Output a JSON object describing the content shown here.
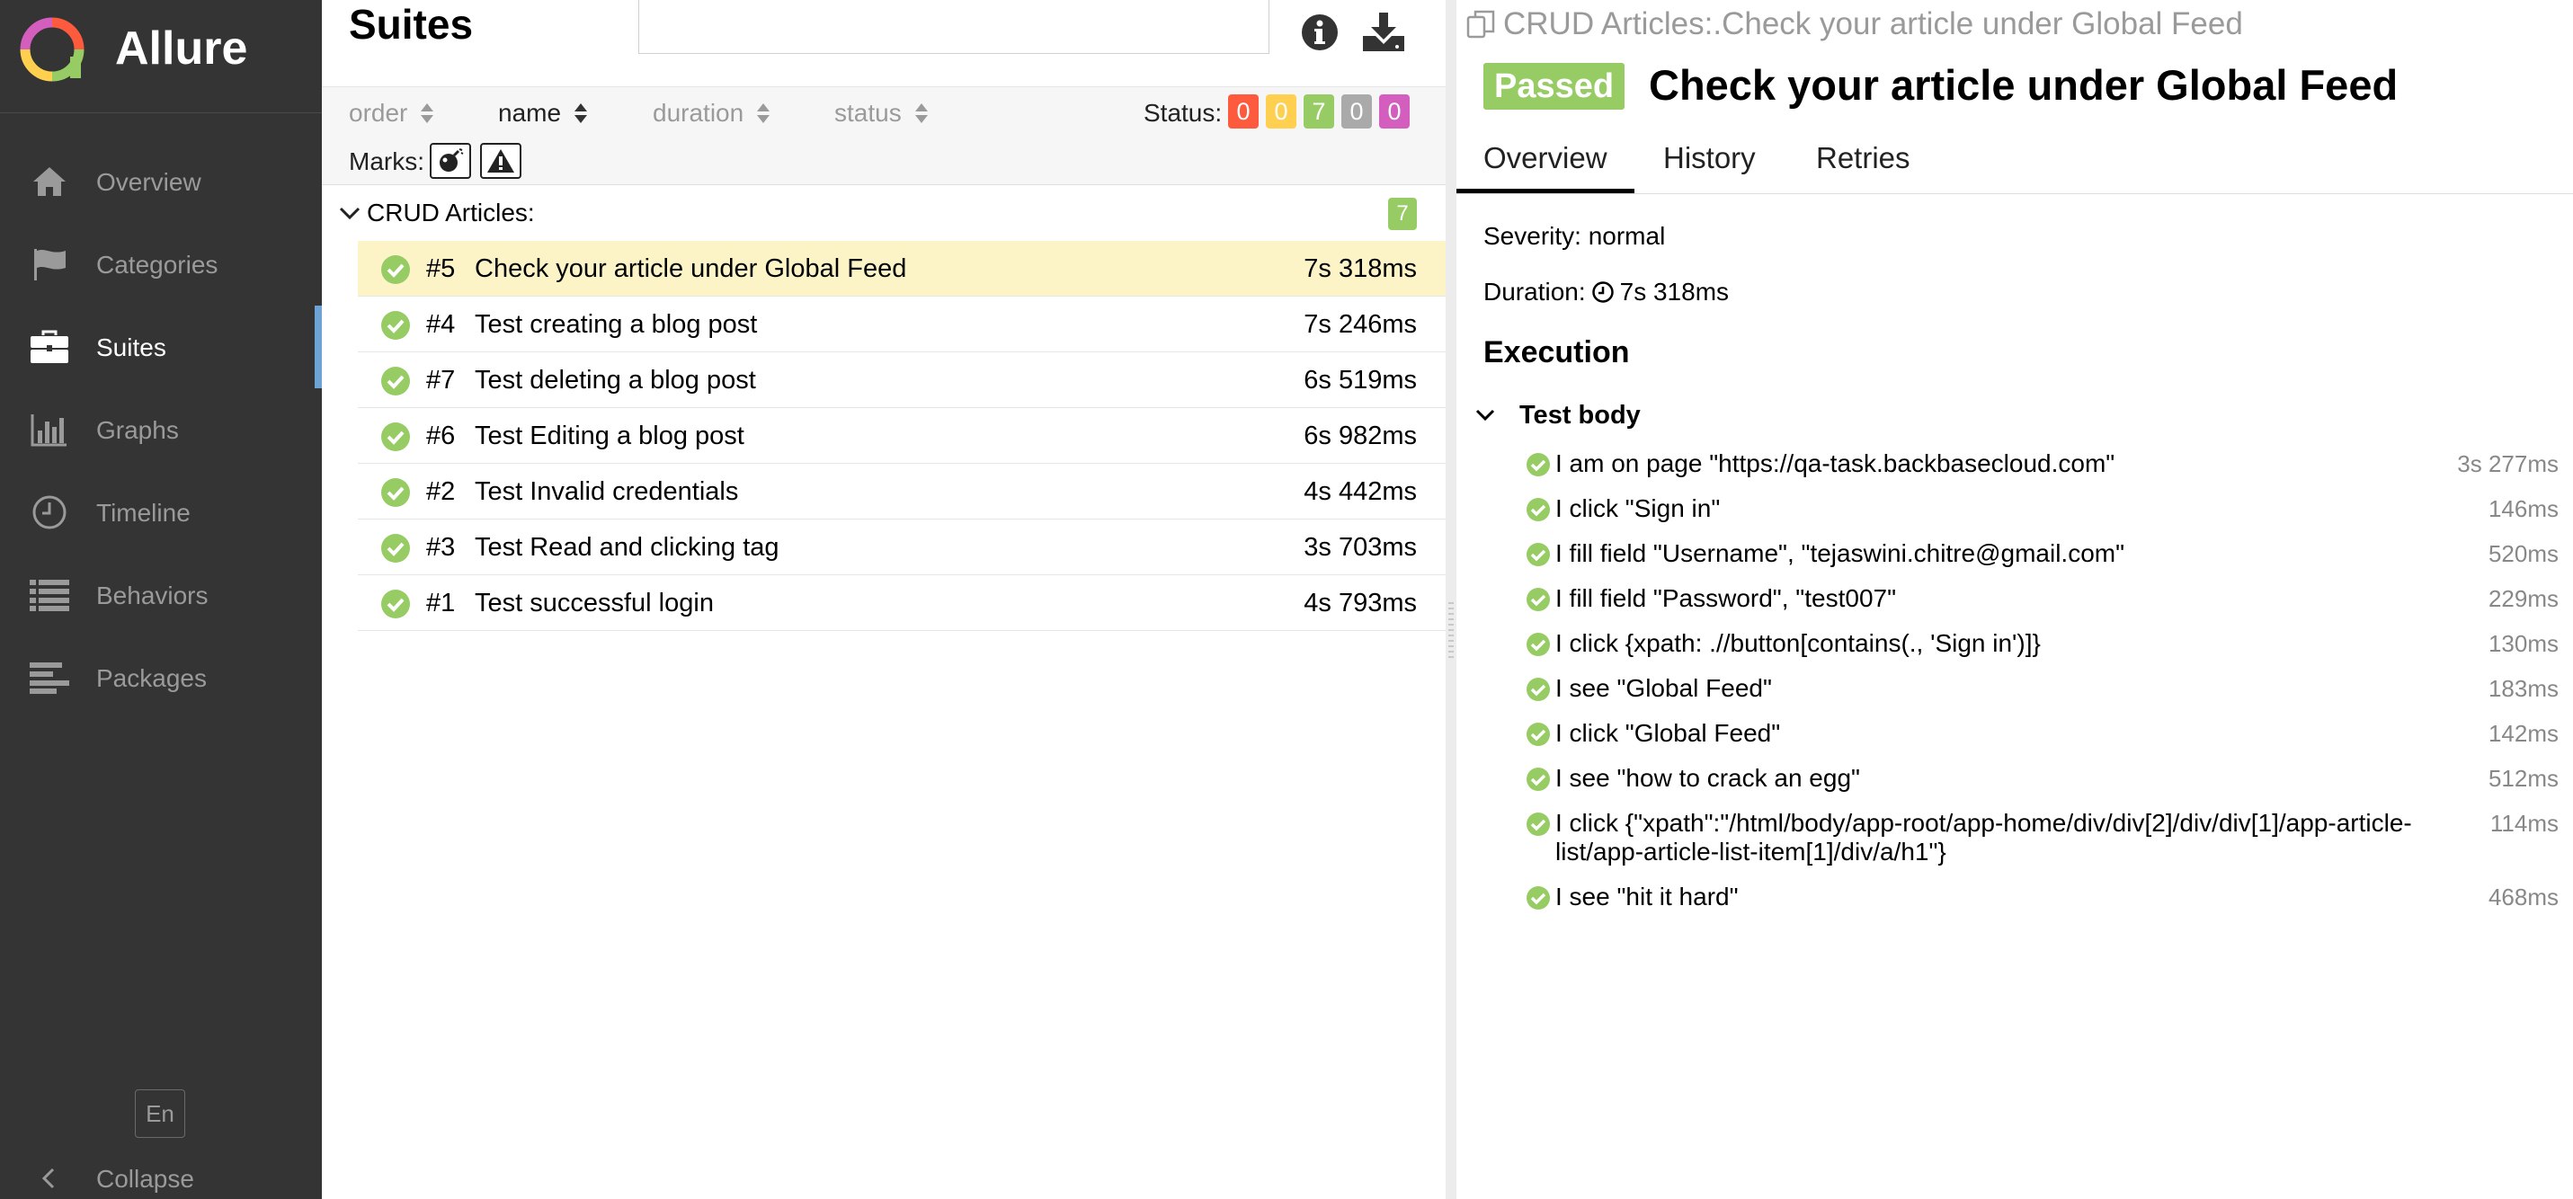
{
  "sidebar": {
    "brand": "Allure",
    "items": [
      {
        "label": "Overview",
        "icon": "home-icon"
      },
      {
        "label": "Categories",
        "icon": "flag-icon"
      },
      {
        "label": "Suites",
        "icon": "briefcase-icon"
      },
      {
        "label": "Graphs",
        "icon": "bar-chart-icon"
      },
      {
        "label": "Timeline",
        "icon": "clock-icon"
      },
      {
        "label": "Behaviors",
        "icon": "list-icon"
      },
      {
        "label": "Packages",
        "icon": "align-left-icon"
      }
    ],
    "active": "Suites",
    "language": "En",
    "collapse_label": "Collapse"
  },
  "suites": {
    "title": "Suites",
    "search_value": "",
    "sorters": {
      "order": "order",
      "name": "name",
      "duration": "duration",
      "status": "status"
    },
    "active_sorter": "name",
    "status_label": "Status:",
    "status_counts": [
      {
        "value": "0",
        "color": "#fd5a3e"
      },
      {
        "value": "0",
        "color": "#ffd050"
      },
      {
        "value": "7",
        "color": "#97cc64"
      },
      {
        "value": "0",
        "color": "#aaaaaa"
      },
      {
        "value": "0",
        "color": "#d35ebe"
      }
    ],
    "marks_label": "Marks:",
    "group": {
      "name": "CRUD Articles:",
      "count": "7"
    },
    "tests": [
      {
        "id": "#5",
        "name": "Check your article under Global Feed",
        "duration": "7s 318ms",
        "selected": true
      },
      {
        "id": "#4",
        "name": "Test creating a blog post",
        "duration": "7s 246ms"
      },
      {
        "id": "#7",
        "name": "Test deleting a blog post",
        "duration": "6s 519ms"
      },
      {
        "id": "#6",
        "name": "Test Editing a blog post",
        "duration": "6s 982ms"
      },
      {
        "id": "#2",
        "name": "Test Invalid credentials",
        "duration": "4s 442ms"
      },
      {
        "id": "#3",
        "name": "Test Read and clicking tag",
        "duration": "3s 703ms"
      },
      {
        "id": "#1",
        "name": "Test successful login",
        "duration": "4s 793ms"
      }
    ]
  },
  "detail": {
    "breadcrumb": "CRUD Articles:.Check your article under Global Feed",
    "status_badge": "Passed",
    "title": "Check your article under Global Feed",
    "tabs": [
      "Overview",
      "History",
      "Retries"
    ],
    "active_tab": "Overview",
    "severity": "Severity: normal",
    "duration_label": "Duration:",
    "duration_value": "7s 318ms",
    "execution_title": "Execution",
    "body_title": "Test body",
    "steps": [
      {
        "text": "I am on page \"https://qa-task.backbasecloud.com\"",
        "duration": "3s 277ms"
      },
      {
        "text": "I click \"Sign in\"",
        "duration": "146ms"
      },
      {
        "text": "I fill field \"Username\", \"tejaswini.chitre@gmail.com\"",
        "duration": "520ms"
      },
      {
        "text": "I fill field \"Password\", \"test007\"",
        "duration": "229ms"
      },
      {
        "text": "I click {xpath: .//button[contains(., 'Sign in')]}",
        "duration": "130ms"
      },
      {
        "text": "I see \"Global Feed\"",
        "duration": "183ms"
      },
      {
        "text": "I click \"Global Feed\"",
        "duration": "142ms"
      },
      {
        "text": "I see \"how to crack an egg\"",
        "duration": "512ms"
      },
      {
        "text": "I click {\"xpath\":\"/html/body/app-root/app-home/div/div[2]/div/div[1]/app-article-list/app-article-list-item[1]/div/a/h1\"}",
        "duration": "114ms"
      },
      {
        "text": "I see \"hit it hard\"",
        "duration": "468ms"
      }
    ]
  },
  "colors": {
    "passed": "#97cc64",
    "sidebar_bg": "#343434",
    "selected_row": "#fcf4c7",
    "active_marker": "#6ea3d6"
  }
}
